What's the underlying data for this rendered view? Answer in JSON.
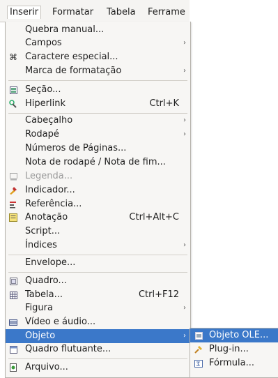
{
  "menubar": {
    "items": [
      {
        "label": "Inserir"
      },
      {
        "label": "Formatar"
      },
      {
        "label": "Tabela"
      },
      {
        "label": "Ferrame"
      }
    ]
  },
  "menu": {
    "items": [
      {
        "label": "Quebra manual..."
      },
      {
        "label": "Campos"
      },
      {
        "label": "Caractere especial..."
      },
      {
        "label": "Marca de formatação"
      },
      {
        "label": "Seção..."
      },
      {
        "label": "Hiperlink",
        "accel": "Ctrl+K"
      },
      {
        "label": "Cabeçalho"
      },
      {
        "label": "Rodapé"
      },
      {
        "label": "Números de Páginas..."
      },
      {
        "label": "Nota de rodapé / Nota de fim..."
      },
      {
        "label": "Legenda..."
      },
      {
        "label": "Indicador..."
      },
      {
        "label": "Referência..."
      },
      {
        "label": "Anotação",
        "accel": "Ctrl+Alt+C"
      },
      {
        "label": "Script..."
      },
      {
        "label": "Índices"
      },
      {
        "label": "Envelope..."
      },
      {
        "label": "Quadro..."
      },
      {
        "label": "Tabela...",
        "accel": "Ctrl+F12"
      },
      {
        "label": "Figura"
      },
      {
        "label": "Vídeo e áudio..."
      },
      {
        "label": "Objeto"
      },
      {
        "label": "Quadro flutuante..."
      },
      {
        "label": "Arquivo..."
      }
    ]
  },
  "submenu": {
    "items": [
      {
        "label": "Objeto OLE..."
      },
      {
        "label": "Plug-in..."
      },
      {
        "label": "Fórmula..."
      }
    ]
  },
  "colors": {
    "highlight": "#3b78c9",
    "menu_bg": "#f7f6f4"
  }
}
